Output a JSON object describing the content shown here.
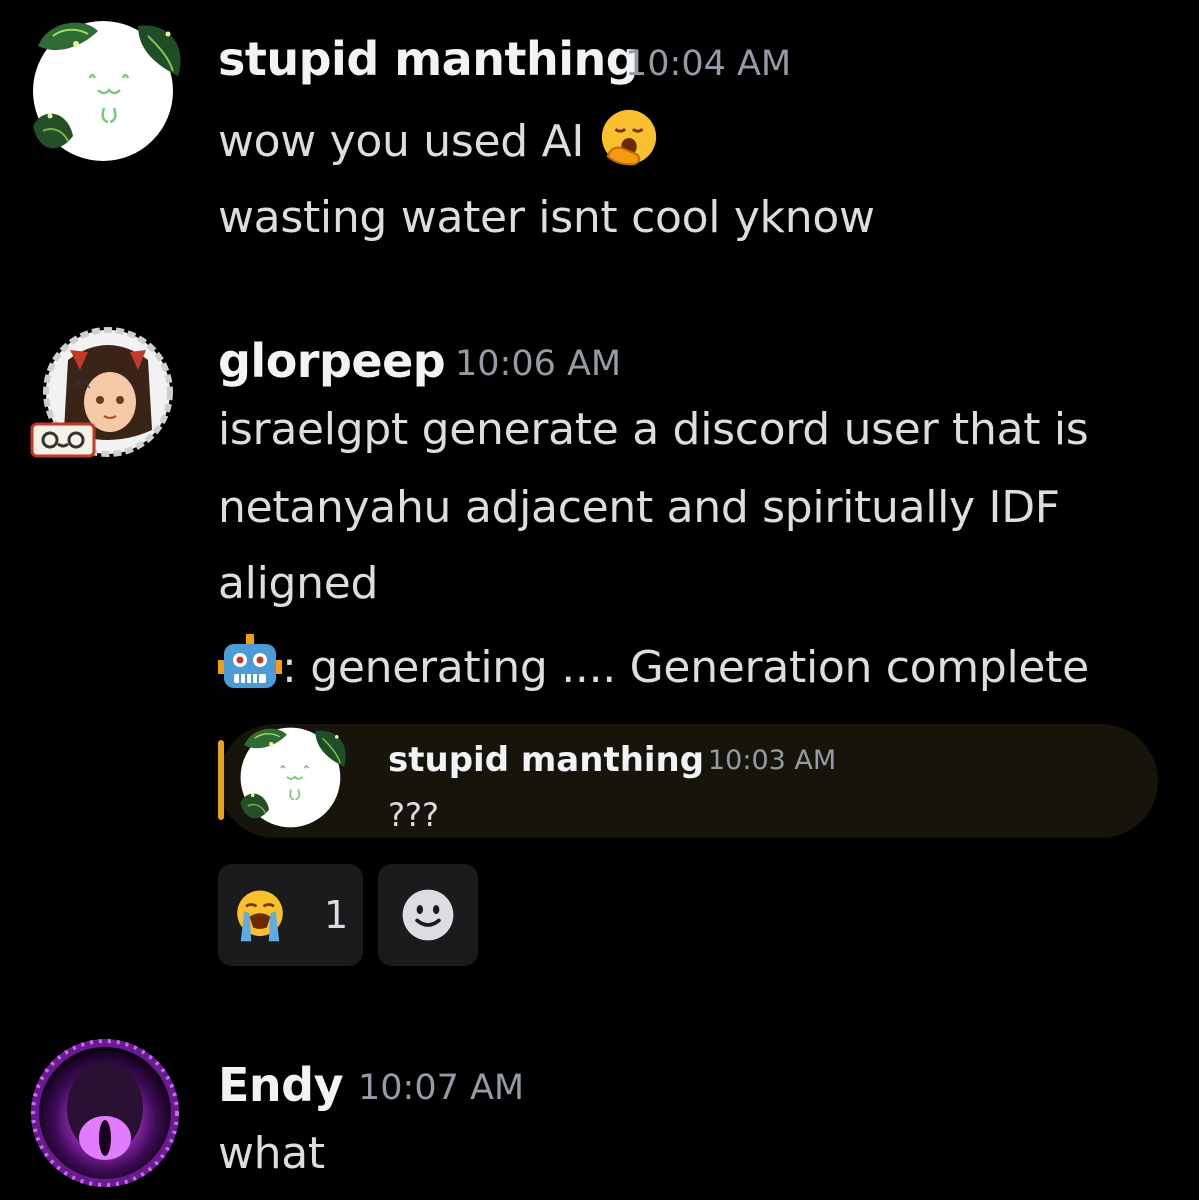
{
  "messages": [
    {
      "author": "stupid manthing",
      "time": "10:04 AM",
      "lines": [
        "wow you used AI",
        "wasting water isnt cool yknow"
      ],
      "line1_emoji_icon": "yawning-face-icon",
      "avatar_icon": "leafy-blob-avatar-icon"
    },
    {
      "author": "glorpeep",
      "time": "10:06 AM",
      "lines": [
        "israelgpt generate a discord user that is",
        "netanyahu adjacent and spiritually IDF",
        "aligned",
        ": generating .... Generation complete"
      ],
      "line4_emoji_icon": "robot-face-icon",
      "avatar_icon": "anime-girl-avatar-icon",
      "reply": {
        "author": "stupid manthing",
        "time": "10:03 AM",
        "text": "???",
        "accent_color": "#e6a11e"
      },
      "reactions": [
        {
          "emoji_icon": "loudly-crying-face-icon",
          "count": "1"
        },
        {
          "emoji_icon": "add-reaction-smiley-icon",
          "count": ""
        }
      ]
    },
    {
      "author": "Endy",
      "time": "10:07 AM",
      "lines": [
        "what"
      ],
      "avatar_icon": "purple-eye-orb-avatar-icon"
    }
  ]
}
